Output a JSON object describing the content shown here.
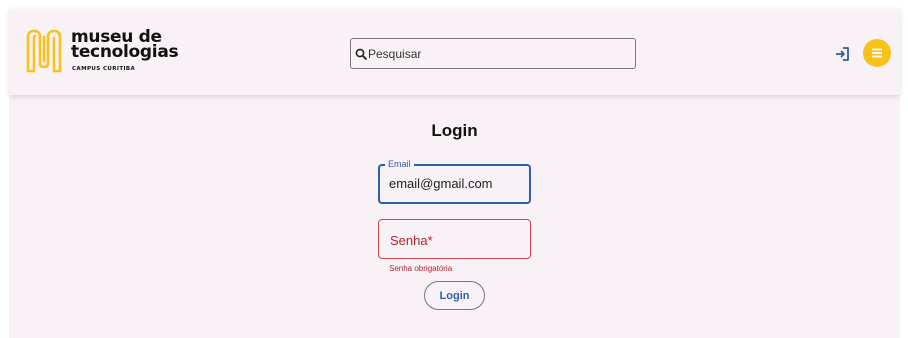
{
  "header": {
    "logo": {
      "line1": "museu de",
      "line2": "tecnologias",
      "sub": "CAMPUS CURITIBA"
    },
    "search": {
      "placeholder": "Pesquisar",
      "icon": "search-icon"
    },
    "login_icon": "login-icon",
    "menu_icon": "menu-icon"
  },
  "login": {
    "title": "Login",
    "email": {
      "label": "Email",
      "value": "email@gmail.com"
    },
    "password": {
      "label": "Senha*",
      "error": "Senha obrigatória"
    },
    "submit_label": "Login"
  },
  "colors": {
    "brand_yellow": "#f7c21a",
    "primary": "#2f5fa8",
    "error": "#b3262e",
    "surface": "#f8f1f6"
  }
}
